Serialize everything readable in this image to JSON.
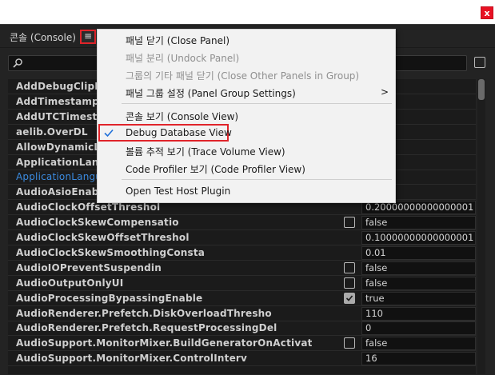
{
  "window": {
    "close_label": "x"
  },
  "panel": {
    "title": "콘솔 (Console)",
    "menu_glyph": "≡"
  },
  "search": {
    "value": "",
    "placeholder": ""
  },
  "rows": [
    {
      "name": "AddDebugClipIn",
      "value": null,
      "check": null,
      "link": false
    },
    {
      "name": "AddTimestampTo",
      "value": null,
      "check": null,
      "link": false
    },
    {
      "name": "AddUTCTimestamp",
      "value": null,
      "check": null,
      "link": false
    },
    {
      "name": "aelib.OverDL",
      "value": null,
      "check": null,
      "link": false
    },
    {
      "name": "AllowDynamicLi",
      "value": null,
      "check": null,
      "link": false
    },
    {
      "name": "ApplicationLang",
      "value": null,
      "check": null,
      "link": false
    },
    {
      "name": "ApplicationLangua",
      "value": null,
      "check": null,
      "link": true
    },
    {
      "name": "AudioAsioEnab",
      "value": null,
      "check": null,
      "link": false
    },
    {
      "name": "AudioClockOffsetThreshol",
      "value": "0.20000000000000001",
      "check": null,
      "link": false
    },
    {
      "name": "AudioClockSkewCompensatio",
      "value": "false",
      "check": false,
      "link": false
    },
    {
      "name": "AudioClockSkewOffsetThreshol",
      "value": "0.10000000000000001",
      "check": null,
      "link": false
    },
    {
      "name": "AudioClockSkewSmoothingConsta",
      "value": "0.01",
      "check": null,
      "link": false
    },
    {
      "name": "AudioIOPreventSuspendin",
      "value": "false",
      "check": false,
      "link": false
    },
    {
      "name": "AudioOutputOnlyUI",
      "value": "false",
      "check": false,
      "link": false
    },
    {
      "name": "AudioProcessingBypassingEnable",
      "value": "true",
      "check": true,
      "link": false
    },
    {
      "name": "AudioRenderer.Prefetch.DiskOverloadThresho",
      "value": "110",
      "check": null,
      "link": false
    },
    {
      "name": "AudioRenderer.Prefetch.RequestProcessingDel",
      "value": "0",
      "check": null,
      "link": false
    },
    {
      "name": "AudioSupport.MonitorMixer.BuildGeneratorOnActivat",
      "value": "false",
      "check": false,
      "link": false
    },
    {
      "name": "AudioSupport.MonitorMixer.ControlInterv",
      "value": "16",
      "check": null,
      "link": false
    }
  ],
  "menu": {
    "items": [
      {
        "label": "패널 닫기 (Close Panel)",
        "disabled": false
      },
      {
        "label": "패널 분리 (Undock Panel)",
        "disabled": true
      },
      {
        "label": "그룹의 기타 패널 닫기 (Close Other Panels in Group)",
        "disabled": true
      },
      {
        "label": "패널 그룹 설정 (Panel Group Settings)",
        "disabled": false,
        "submenu_arrow": ">"
      },
      {
        "label": "콘솔 보기 (Console View)",
        "disabled": false
      },
      {
        "label": "Debug Database View",
        "disabled": false,
        "checked": true
      },
      {
        "label": "볼륨 추적 보기 (Trace Volume View)",
        "disabled": false
      },
      {
        "label": "Code Profiler 보기 (Code Profiler View)",
        "disabled": false
      },
      {
        "label": "Open Test Host Plugin",
        "disabled": false
      }
    ]
  },
  "colors": {
    "panel_bg": "#232323",
    "accent_highlight": "#e0242a",
    "link": "#3b8be0",
    "check_blue": "#1e6fd9"
  }
}
